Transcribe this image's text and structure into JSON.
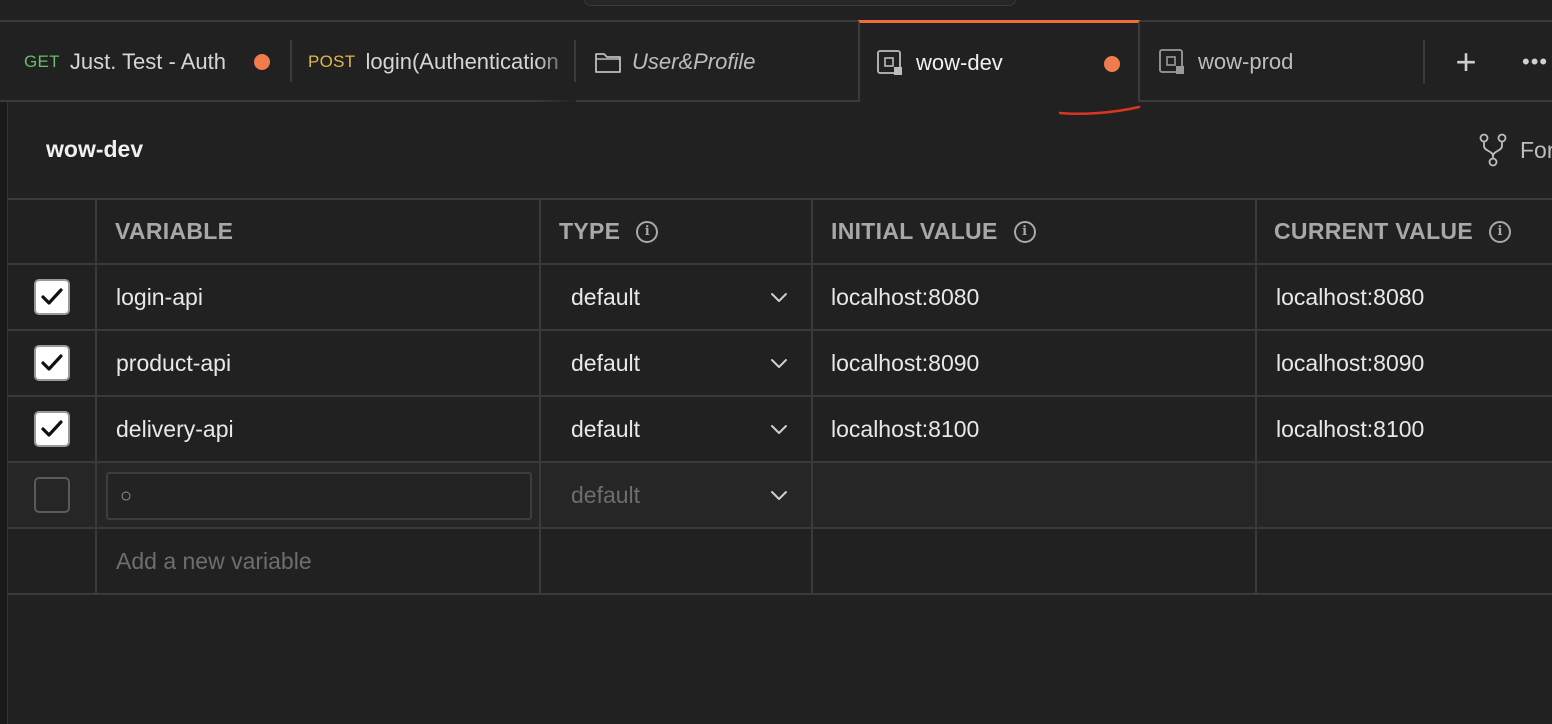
{
  "tabs": [
    {
      "method": "GET",
      "label": "Just. Test - Auth",
      "unsaved": true,
      "kind": "request"
    },
    {
      "method": "POST",
      "label": "login(Authentication",
      "unsaved": false,
      "kind": "request"
    },
    {
      "label": "User&Profile",
      "kind": "folder"
    },
    {
      "label": "wow-dev",
      "unsaved": true,
      "active": true,
      "kind": "environment"
    },
    {
      "label": "wow-prod",
      "kind": "environment"
    }
  ],
  "environment": {
    "title": "wow-dev",
    "fork_label": "For"
  },
  "table": {
    "headers": {
      "variable": "VARIABLE",
      "type": "TYPE",
      "initial_value": "INITIAL VALUE",
      "current_value": "CURRENT VALUE"
    },
    "rows": [
      {
        "enabled": true,
        "variable": "login-api",
        "type": "default",
        "initial_value": "localhost:8080",
        "current_value": "localhost:8080"
      },
      {
        "enabled": true,
        "variable": "product-api",
        "type": "default",
        "initial_value": "localhost:8090",
        "current_value": "localhost:8090"
      },
      {
        "enabled": true,
        "variable": "delivery-api",
        "type": "default",
        "initial_value": "localhost:8100",
        "current_value": "localhost:8100"
      }
    ],
    "new_row": {
      "enabled": false,
      "variable_value": "○",
      "type_placeholder": "default"
    },
    "add_placeholder": "Add a new variable"
  },
  "colors": {
    "accent": "#f26b3a",
    "unsaved_dot": "#f07c4c",
    "get": "#6bbb6b",
    "post": "#e0b74a",
    "background": "#212121"
  },
  "icons": {
    "new_tab": "plus-icon",
    "more": "more-icon",
    "fork": "fork-icon",
    "info": "info-icon",
    "dropdown": "chevron-down-icon",
    "folder": "folder-icon",
    "environment": "environment-icon"
  }
}
